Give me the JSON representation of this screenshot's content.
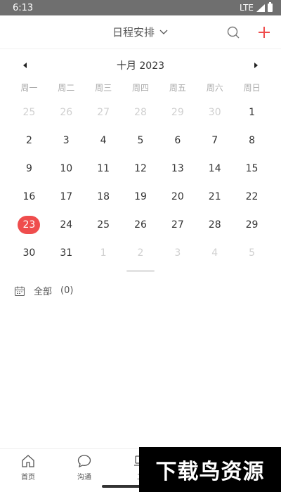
{
  "status_bar": {
    "time": "6:13",
    "network": "LTE"
  },
  "header": {
    "title": "日程安排"
  },
  "calendar": {
    "month_label": "十月 2023",
    "weekdays": [
      "周一",
      "周二",
      "周三",
      "周四",
      "周五",
      "周六",
      "周日"
    ],
    "days": [
      {
        "label": "25",
        "muted": true
      },
      {
        "label": "26",
        "muted": true
      },
      {
        "label": "27",
        "muted": true
      },
      {
        "label": "28",
        "muted": true
      },
      {
        "label": "29",
        "muted": true
      },
      {
        "label": "30",
        "muted": true
      },
      {
        "label": "1"
      },
      {
        "label": "2"
      },
      {
        "label": "3"
      },
      {
        "label": "4"
      },
      {
        "label": "5"
      },
      {
        "label": "6"
      },
      {
        "label": "7"
      },
      {
        "label": "8"
      },
      {
        "label": "9"
      },
      {
        "label": "10"
      },
      {
        "label": "11"
      },
      {
        "label": "12"
      },
      {
        "label": "13"
      },
      {
        "label": "14"
      },
      {
        "label": "15"
      },
      {
        "label": "16"
      },
      {
        "label": "17"
      },
      {
        "label": "18"
      },
      {
        "label": "19"
      },
      {
        "label": "20"
      },
      {
        "label": "21"
      },
      {
        "label": "22"
      },
      {
        "label": "23",
        "today": true
      },
      {
        "label": "24"
      },
      {
        "label": "25"
      },
      {
        "label": "26"
      },
      {
        "label": "27"
      },
      {
        "label": "28"
      },
      {
        "label": "29"
      },
      {
        "label": "30"
      },
      {
        "label": "31"
      },
      {
        "label": "1",
        "muted": true
      },
      {
        "label": "2",
        "muted": true
      },
      {
        "label": "3",
        "muted": true
      },
      {
        "label": "4",
        "muted": true
      },
      {
        "label": "5",
        "muted": true
      }
    ],
    "today_color": "#ef4d4d"
  },
  "filter": {
    "label": "全部",
    "count": "(0)"
  },
  "tabs": [
    {
      "label": "首页",
      "icon": "home-icon"
    },
    {
      "label": "沟通",
      "icon": "chat-icon"
    },
    {
      "label": "工",
      "icon": "laptop-icon"
    },
    {
      "label": "",
      "icon": ""
    },
    {
      "label": "",
      "icon": ""
    }
  ],
  "watermark": {
    "text": "下载鸟资源"
  },
  "colors": {
    "accent": "#ef4d4d",
    "status_bar": "#6f6f6f"
  }
}
